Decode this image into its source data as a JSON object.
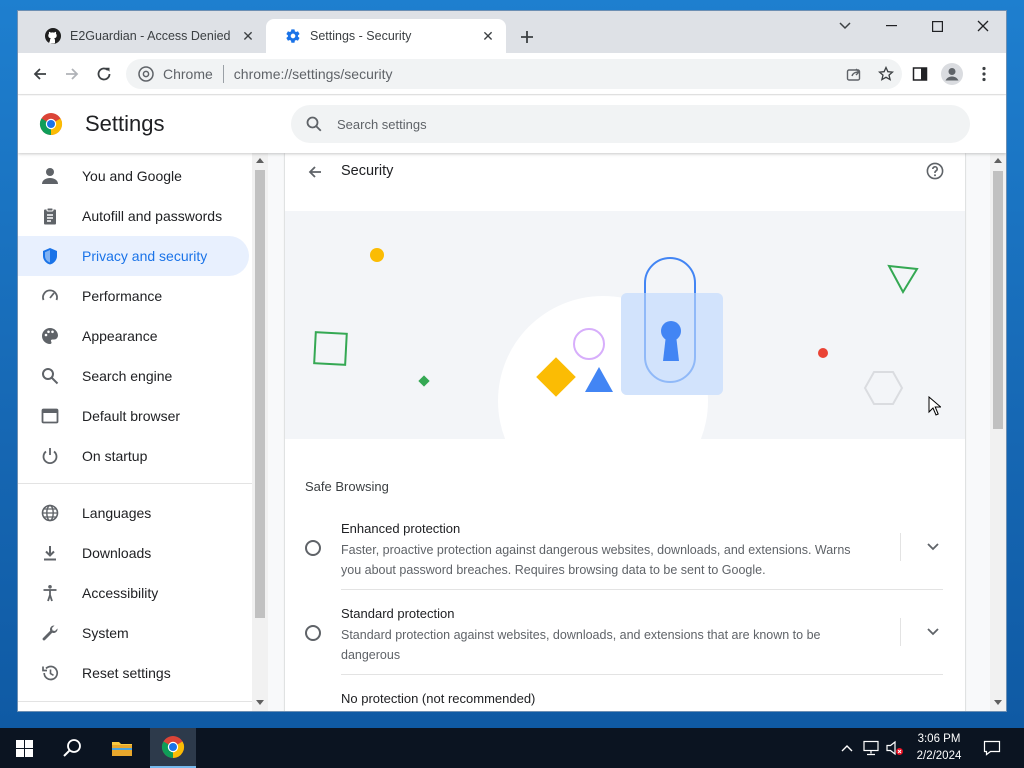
{
  "browser": {
    "tabs": [
      {
        "title": "E2Guardian - Access Denied",
        "icon": "github-icon",
        "active": false
      },
      {
        "title": "Settings - Security",
        "icon": "gear-icon",
        "active": true
      }
    ],
    "omnibox": {
      "site_chip": "Chrome",
      "url": "chrome://settings/security"
    }
  },
  "settings": {
    "title": "Settings",
    "search_placeholder": "Search settings",
    "nav": [
      {
        "label": "You and Google",
        "icon": "person-icon",
        "selected": false
      },
      {
        "label": "Autofill and passwords",
        "icon": "clipboard-icon",
        "selected": false
      },
      {
        "label": "Privacy and security",
        "icon": "shield-icon",
        "selected": true
      },
      {
        "label": "Performance",
        "icon": "speedometer-icon",
        "selected": false
      },
      {
        "label": "Appearance",
        "icon": "palette-icon",
        "selected": false
      },
      {
        "label": "Search engine",
        "icon": "search-icon",
        "selected": false
      },
      {
        "label": "Default browser",
        "icon": "browser-window-icon",
        "selected": false
      },
      {
        "label": "On startup",
        "icon": "power-icon",
        "selected": false
      },
      {
        "label": "Languages",
        "icon": "globe-icon",
        "selected": false
      },
      {
        "label": "Downloads",
        "icon": "download-icon",
        "selected": false
      },
      {
        "label": "Accessibility",
        "icon": "accessibility-icon",
        "selected": false
      },
      {
        "label": "System",
        "icon": "wrench-icon",
        "selected": false
      },
      {
        "label": "Reset settings",
        "icon": "history-icon",
        "selected": false
      }
    ],
    "security": {
      "title": "Security",
      "safe_browsing_heading": "Safe Browsing",
      "options": [
        {
          "title": "Enhanced protection",
          "description": "Faster, proactive protection against dangerous websites, downloads, and extensions. Warns you about password breaches. Requires browsing data to be sent to Google.",
          "selected": false
        },
        {
          "title": "Standard protection",
          "description": "Standard protection against websites, downloads, and extensions that are known to be dangerous",
          "selected": false
        },
        {
          "title": "No protection (not recommended)",
          "description": "",
          "selected": false
        }
      ]
    }
  },
  "taskbar": {
    "time": "3:06 PM",
    "date": "2/2/2024"
  },
  "colors": {
    "accent": "#1a73e8",
    "selected_nav_bg": "#e8f0fe",
    "taskbar": "#0b1421"
  }
}
